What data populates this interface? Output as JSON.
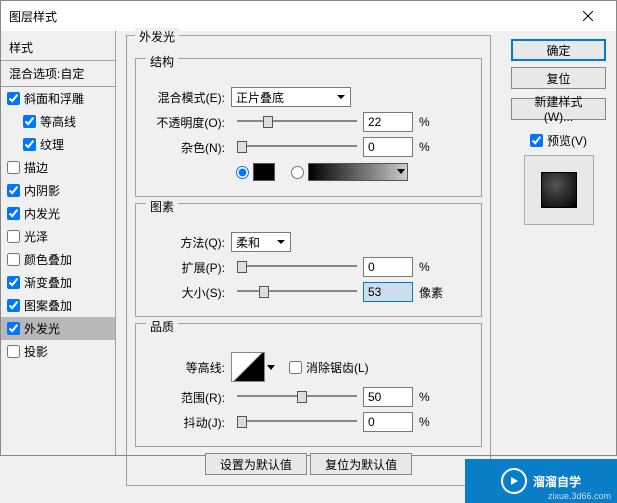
{
  "window": {
    "title": "图层样式",
    "close": "×"
  },
  "sidebar": {
    "header": "样式",
    "subheader": "混合选项:自定",
    "items": [
      {
        "label": "斜面和浮雕",
        "checked": true,
        "indent": false
      },
      {
        "label": "等高线",
        "checked": true,
        "indent": true
      },
      {
        "label": "纹理",
        "checked": true,
        "indent": true
      },
      {
        "label": "描边",
        "checked": false,
        "indent": false
      },
      {
        "label": "内阴影",
        "checked": true,
        "indent": false
      },
      {
        "label": "内发光",
        "checked": true,
        "indent": false
      },
      {
        "label": "光泽",
        "checked": false,
        "indent": false
      },
      {
        "label": "颜色叠加",
        "checked": false,
        "indent": false
      },
      {
        "label": "渐变叠加",
        "checked": true,
        "indent": false
      },
      {
        "label": "图案叠加",
        "checked": true,
        "indent": false
      },
      {
        "label": "外发光",
        "checked": true,
        "indent": false,
        "selected": true
      },
      {
        "label": "投影",
        "checked": false,
        "indent": false
      }
    ]
  },
  "panel": {
    "title": "外发光",
    "struct": {
      "legend": "结构",
      "blend_label": "混合模式(E):",
      "blend_value": "正片叠底",
      "opacity_label": "不透明度(O):",
      "opacity_value": "22",
      "opacity_unit": "%",
      "noise_label": "杂色(N):",
      "noise_value": "0",
      "noise_unit": "%",
      "color_black": "#000000"
    },
    "elem": {
      "legend": "图素",
      "method_label": "方法(Q):",
      "method_value": "柔和",
      "spread_label": "扩展(P):",
      "spread_value": "0",
      "spread_unit": "%",
      "size_label": "大小(S):",
      "size_value": "53",
      "size_unit": "像素"
    },
    "quality": {
      "legend": "品质",
      "contour_label": "等高线:",
      "antialias_label": "消除锯齿(L)",
      "range_label": "范围(R):",
      "range_value": "50",
      "range_unit": "%",
      "jitter_label": "抖动(J):",
      "jitter_value": "0",
      "jitter_unit": "%"
    },
    "bottom": {
      "make_default": "设置为默认值",
      "reset_default": "复位为默认值"
    }
  },
  "right": {
    "ok": "确定",
    "reset": "复位",
    "new_style": "新建样式(W)...",
    "preview_label": "预览(V)",
    "preview_checked": true
  },
  "watermark": {
    "text": "溜溜自学",
    "url": "zixue.3d66.com"
  }
}
